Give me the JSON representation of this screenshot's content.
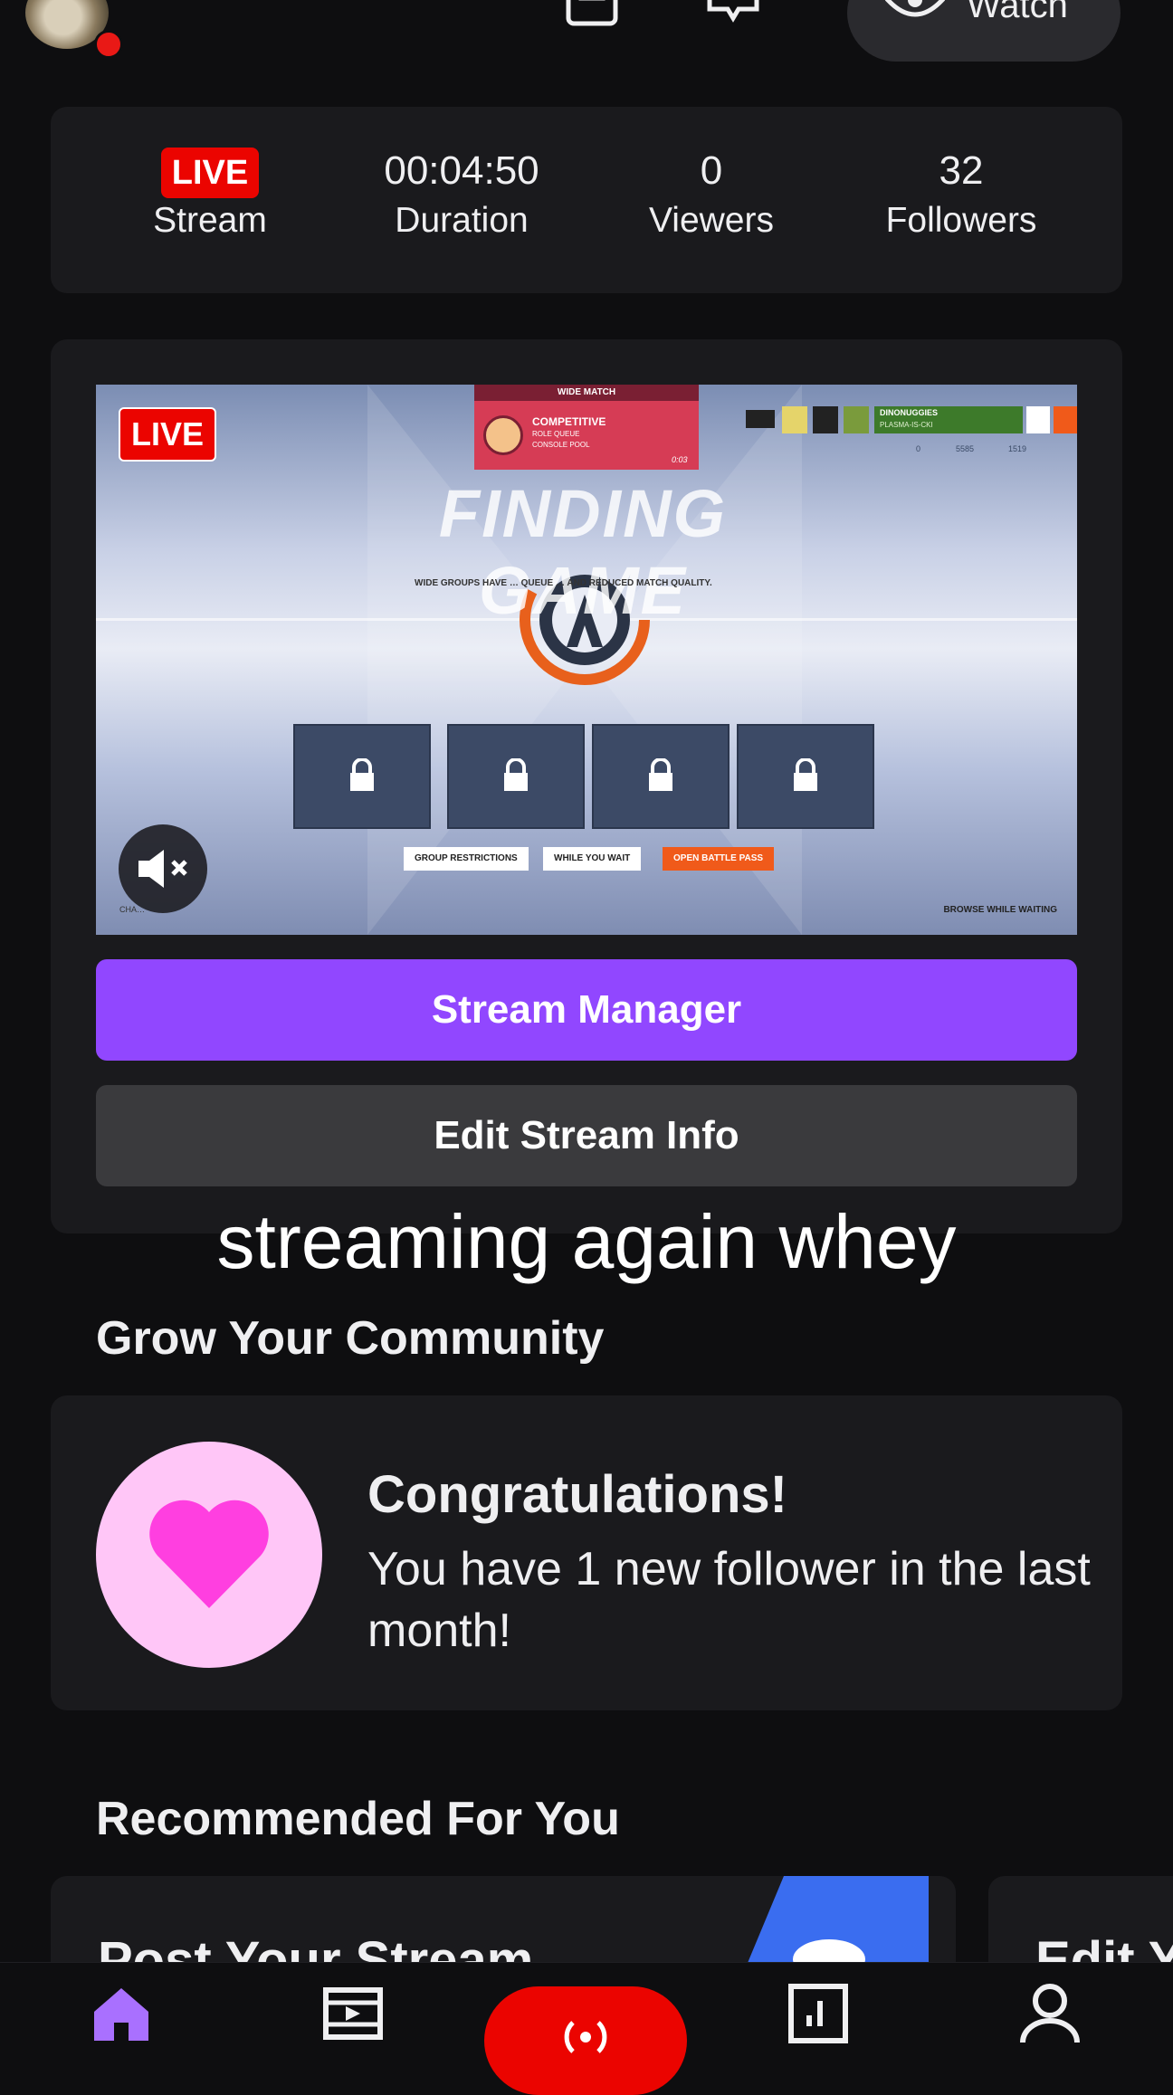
{
  "header": {
    "watch_label": "Watch"
  },
  "stats": [
    {
      "value": "LIVE",
      "label": "Stream",
      "is_badge": true
    },
    {
      "value": "00:04:50",
      "label": "Duration"
    },
    {
      "value": "0",
      "label": "Viewers"
    },
    {
      "value": "32",
      "label": "Followers"
    }
  ],
  "preview": {
    "live_badge": "LIVE",
    "finding_text": "FINDING GAME",
    "wide_match": "WIDE MATCH",
    "mode_title": "COMPETITIVE",
    "mode_sub1": "ROLE QUEUE",
    "mode_sub2": "CONSOLE POOL",
    "timer": "0:03",
    "player_name": "DINONUGGIES",
    "player_tag": "PLASMA-IS-CKI",
    "stat_a": "0",
    "stat_b": "5585",
    "stat_c": "1519",
    "warning": "WIDE GROUPS HAVE …                  QUEUE …     AND REDUCED MATCH QUALITY.",
    "chip_group": "GROUP RESTRICTIONS",
    "chip_wait": "WHILE YOU WAIT",
    "chip_pass": "OPEN BATTLE PASS",
    "browse": "BROWSE WHILE WAITING",
    "chat_label": "CHA…"
  },
  "buttons": {
    "stream_manager": "Stream Manager",
    "edit_stream_info": "Edit Stream Info"
  },
  "stream_title": "streaming again whey",
  "community": {
    "heading": "Grow Your Community",
    "congrats_title": "Congratulations!",
    "congrats_body": "You have 1 new follower in the last month!"
  },
  "recommended": {
    "heading": "Recommended For You",
    "card1_title": "Post Your Stream",
    "card2_title": "Edit Y"
  },
  "colors": {
    "brand_purple": "#9147ff",
    "live_red": "#eb0400",
    "nav_active": "#a970ff",
    "heart_pink": "#ff3fe0"
  },
  "nav": [
    "home-icon",
    "clips-icon",
    "go-live-icon",
    "analytics-icon",
    "profile-icon"
  ]
}
